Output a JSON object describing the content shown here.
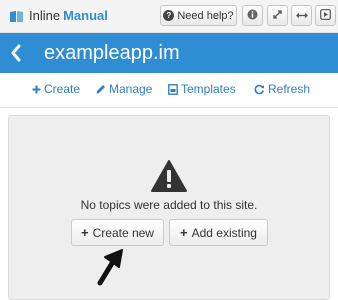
{
  "topbar": {
    "brand_word1": "Inline",
    "brand_word2": "Manual",
    "help_label": "Need help?",
    "icons": [
      "info-icon",
      "expand-icon",
      "resize-horizontal-icon",
      "play-icon"
    ]
  },
  "header": {
    "back_icon": "chevron-left-icon",
    "site_title": "exampleapp.im"
  },
  "toolbar": {
    "create_label": "Create",
    "manage_label": "Manage",
    "templates_label": "Templates",
    "refresh_label": "Refresh"
  },
  "empty_state": {
    "icon": "warning-icon",
    "message": "No topics were added to this site.",
    "create_new_label": "Create new",
    "add_existing_label": "Add existing"
  },
  "colors": {
    "brand_blue": "#2f8ed3",
    "link_blue": "#2f7fc4",
    "panel_bg": "#eeeeee"
  }
}
